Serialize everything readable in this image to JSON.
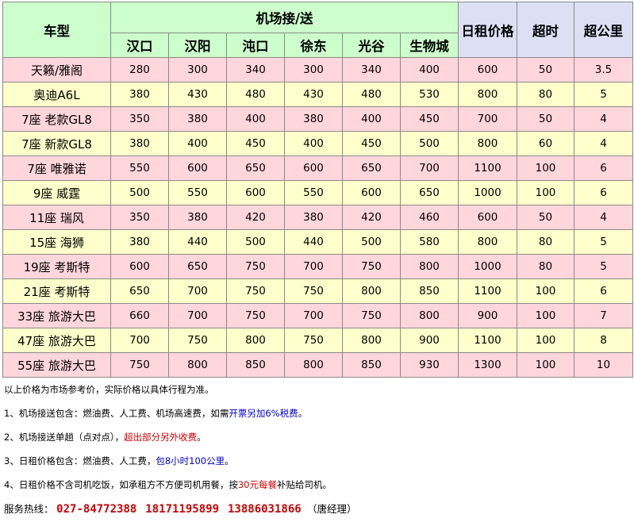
{
  "header": {
    "model": "车型",
    "airport": "机场接/送",
    "locations": [
      "汉口",
      "汉阳",
      "沌口",
      "徐东",
      "光谷",
      "生物城"
    ],
    "daily": "日租价格",
    "overtime": "超时",
    "overkm": "超公里"
  },
  "rows": [
    {
      "model": "天籁/雅阁",
      "prices": [
        "280",
        "300",
        "340",
        "300",
        "340",
        "400"
      ],
      "daily": "600",
      "overtime": "50",
      "overkm": "3.5"
    },
    {
      "model": "奥迪A6L",
      "prices": [
        "380",
        "430",
        "480",
        "430",
        "480",
        "530"
      ],
      "daily": "800",
      "overtime": "80",
      "overkm": "5"
    },
    {
      "model": "7座 老款GL8",
      "prices": [
        "350",
        "380",
        "400",
        "380",
        "400",
        "450"
      ],
      "daily": "700",
      "overtime": "50",
      "overkm": "4"
    },
    {
      "model": "7座 新款GL8",
      "prices": [
        "380",
        "400",
        "450",
        "400",
        "450",
        "500"
      ],
      "daily": "800",
      "overtime": "60",
      "overkm": "4"
    },
    {
      "model": "7座 唯雅诺",
      "prices": [
        "550",
        "600",
        "650",
        "600",
        "650",
        "700"
      ],
      "daily": "1100",
      "overtime": "100",
      "overkm": "6"
    },
    {
      "model": "9座 威霆",
      "prices": [
        "500",
        "550",
        "600",
        "550",
        "600",
        "650"
      ],
      "daily": "1000",
      "overtime": "100",
      "overkm": "6"
    },
    {
      "model": "11座 瑞风",
      "prices": [
        "350",
        "380",
        "420",
        "380",
        "420",
        "460"
      ],
      "daily": "600",
      "overtime": "50",
      "overkm": "4"
    },
    {
      "model": "15座 海狮",
      "prices": [
        "380",
        "440",
        "500",
        "440",
        "500",
        "580"
      ],
      "daily": "800",
      "overtime": "80",
      "overkm": "5"
    },
    {
      "model": "19座 考斯特",
      "prices": [
        "600",
        "650",
        "750",
        "700",
        "750",
        "800"
      ],
      "daily": "1000",
      "overtime": "80",
      "overkm": "5"
    },
    {
      "model": "21座 考斯特",
      "prices": [
        "650",
        "700",
        "750",
        "750",
        "800",
        "850"
      ],
      "daily": "1100",
      "overtime": "100",
      "overkm": "6"
    },
    {
      "model": "33座 旅游大巴",
      "prices": [
        "660",
        "700",
        "750",
        "700",
        "750",
        "800"
      ],
      "daily": "900",
      "overtime": "100",
      "overkm": "7"
    },
    {
      "model": "47座 旅游大巴",
      "prices": [
        "700",
        "750",
        "800",
        "750",
        "800",
        "900"
      ],
      "daily": "1100",
      "overtime": "100",
      "overkm": "8"
    },
    {
      "model": "55座 旅游大巴",
      "prices": [
        "750",
        "800",
        "850",
        "800",
        "850",
        "930"
      ],
      "daily": "1300",
      "overtime": "100",
      "overkm": "10"
    }
  ],
  "colors": {
    "header_green": "#ccffcc",
    "header_blue": "#dde0f5",
    "row_pink": "#ffd6dc",
    "row_yellow": "#ffffcc",
    "highlight_blue": "#0000cc",
    "highlight_red": "#cc0000"
  },
  "notes": {
    "disclaimer": "以上价格为市场参考价，实际价格以具体行程为准。",
    "n1_a": "1、机场接送包含：燃油费、人工费、机场高速费，如需",
    "n1_b": "开票另加6%税费",
    "n1_c": "。",
    "n2_a": "2、机场接送单趟（点对点），",
    "n2_b": "超出部分另外收费",
    "n2_c": "。",
    "n3_a": "3、日租价格包含：燃油费、人工费，",
    "n3_b": "包8小时100公里",
    "n3_c": "。",
    "n4_a": "4、日租价格不含司机吃饭，如承租方不方便司机用餐，按",
    "n4_b": "30元每餐",
    "n4_c": "补贴给司机。"
  },
  "hotline": {
    "label": "服务热线：",
    "phones": [
      "027-84772388",
      "18171195899",
      "13886031866"
    ],
    "contact": "（唐经理）"
  }
}
